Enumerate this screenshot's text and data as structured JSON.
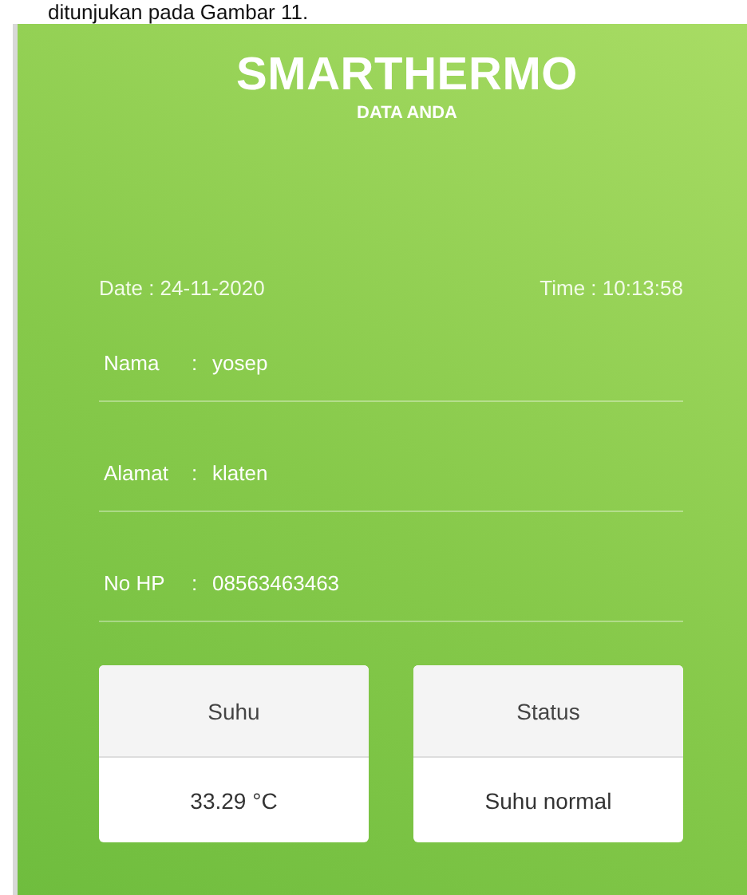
{
  "caption": "ditunjukan pada Gambar 11.",
  "app": {
    "title": "SMARTHERMO",
    "subtitle": "DATA ANDA",
    "date": "Date : 24-11-2020",
    "time": "Time : 10:13:58",
    "fields": [
      {
        "label": "Nama",
        "separator": ":",
        "value": "yosep"
      },
      {
        "label": "Alamat",
        "separator": ":",
        "value": "klaten"
      },
      {
        "label": "No HP",
        "separator": ":",
        "value": "08563463463"
      }
    ],
    "cards": [
      {
        "header": "Suhu",
        "value": "33.29 °C"
      },
      {
        "header": "Status",
        "value": "Suhu normal"
      }
    ]
  }
}
